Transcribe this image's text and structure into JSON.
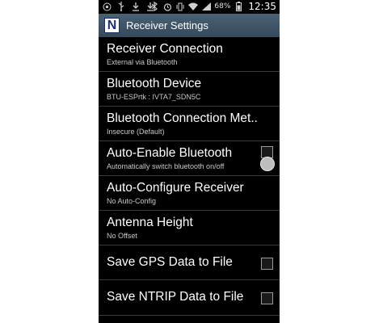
{
  "status_bar": {
    "icons_left": [
      "target-icon",
      "usb-icon",
      "download-icon",
      "download-icon"
    ],
    "icons_right": [
      "bluetooth-icon",
      "alarm-icon",
      "vibrate-icon",
      "wifi-icon",
      "signal-icon",
      "battery-icon"
    ],
    "battery_percent": "68%",
    "time": "12:35"
  },
  "action_bar": {
    "logo_letter": "N",
    "title": "Receiver Settings",
    "color": "#3e5566"
  },
  "settings": [
    {
      "title": "Receiver Connection",
      "summary": "External via Bluetooth"
    },
    {
      "title": "Bluetooth Device",
      "summary": "BTU-ESPrtk : IVTA7_SDN5C"
    },
    {
      "title": "Bluetooth Connection Met..",
      "summary": "Insecure (Default)"
    },
    {
      "title": "Auto-Enable Bluetooth",
      "summary": "Automatically switch bluetooth on/off",
      "checkbox": true
    },
    {
      "title": "Auto-Configure Receiver",
      "summary": "No Auto-Config"
    },
    {
      "title": "Antenna Height",
      "summary": "No Offset"
    },
    {
      "title": "Save GPS Data to File",
      "checkbox": true
    },
    {
      "title": "Save NTRIP Data to File",
      "checkbox": true
    }
  ]
}
